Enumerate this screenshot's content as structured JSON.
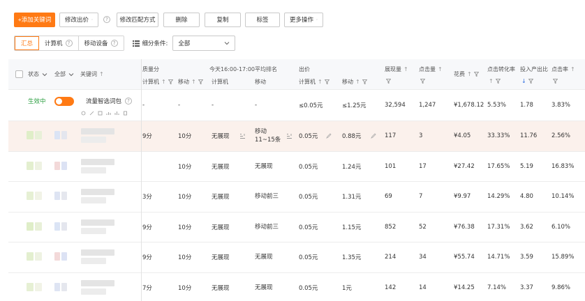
{
  "toolbar": {
    "add_keyword": "+添加关键词",
    "modify_bid": "修改出价",
    "modify_match": "修改匹配方式",
    "delete": "删除",
    "copy": "复制",
    "tag": "标签",
    "more_actions": "更多操作"
  },
  "filter": {
    "tabs": [
      {
        "label": "汇总"
      },
      {
        "label": "计算机"
      },
      {
        "label": "移动设备"
      }
    ],
    "segment_label": "细分条件:",
    "select_value": "全部"
  },
  "columns": {
    "status": "状态",
    "all": "全部",
    "keyword": "关键词",
    "quality_score": "质量分",
    "rank_title": "今天16:00-17:00平均排名",
    "bid": "出价",
    "computer": "计算机",
    "mobile": "移动",
    "impressions": "展现量",
    "clicks": "点击量",
    "cost": "花费",
    "cvr": "点击转化率",
    "roi": "投入产出比",
    "ctr": "点击率"
  },
  "summary_row": {
    "status": "生效中",
    "keyword": "流量智选词包",
    "q_pc": "-",
    "q_mobile": "-",
    "rank_pc": "-",
    "rank_mobile": "-",
    "bid_pc": "≤0.05元",
    "bid_mobile": "≤1.25元",
    "impressions": "32,594",
    "clicks": "1,247",
    "cost": "¥1,678.12",
    "cvr": "5.53%",
    "roi": "1.78",
    "ctr": "3.83%"
  },
  "rows": [
    {
      "q_pc": "9分",
      "q_mobile": "10分",
      "rank_pc": "无展现",
      "rank_mobile": "移动11~15条",
      "bid_pc": "0.05元",
      "bid_mobile": "0.88元",
      "impressions": "117",
      "clicks": "3",
      "cost": "¥4.05",
      "cvr": "33.33%",
      "roi": "11.76",
      "ctr": "2.56%"
    },
    {
      "q_pc": "",
      "q_mobile": "10分",
      "rank_pc": "无展现",
      "rank_mobile": "无展现",
      "bid_pc": "0.05元",
      "bid_mobile": "1.24元",
      "impressions": "101",
      "clicks": "17",
      "cost": "¥27.42",
      "cvr": "17.65%",
      "roi": "5.19",
      "ctr": "16.83%"
    },
    {
      "q_pc": "3分",
      "q_mobile": "10分",
      "rank_pc": "无展现",
      "rank_mobile": "移动前三",
      "bid_pc": "0.05元",
      "bid_mobile": "1.31元",
      "impressions": "69",
      "clicks": "7",
      "cost": "¥9.97",
      "cvr": "14.29%",
      "roi": "4.80",
      "ctr": "10.14%"
    },
    {
      "q_pc": "9分",
      "q_mobile": "10分",
      "rank_pc": "无展现",
      "rank_mobile": "移动前三",
      "bid_pc": "0.05元",
      "bid_mobile": "1.15元",
      "impressions": "852",
      "clicks": "52",
      "cost": "¥76.38",
      "cvr": "17.31%",
      "roi": "3.62",
      "ctr": "6.10%"
    },
    {
      "q_pc": "9分",
      "q_mobile": "10分",
      "rank_pc": "无展现",
      "rank_mobile": "无展现",
      "bid_pc": "0.05元",
      "bid_mobile": "1.35元",
      "impressions": "214",
      "clicks": "34",
      "cost": "¥55.74",
      "cvr": "14.71%",
      "roi": "3.59",
      "ctr": "15.89%"
    },
    {
      "q_pc": "7分",
      "q_mobile": "10分",
      "rank_pc": "无展现",
      "rank_mobile": "无展现",
      "bid_pc": "0.05元",
      "bid_mobile": "1元",
      "impressions": "142",
      "clicks": "14",
      "cost": "¥14.25",
      "cvr": "7.14%",
      "roi": "3.37",
      "ctr": "9.86%"
    }
  ],
  "colors": {
    "accent": "#ff7a14",
    "active_status": "#2ea043",
    "highlight_row": "#fbf1ec"
  }
}
